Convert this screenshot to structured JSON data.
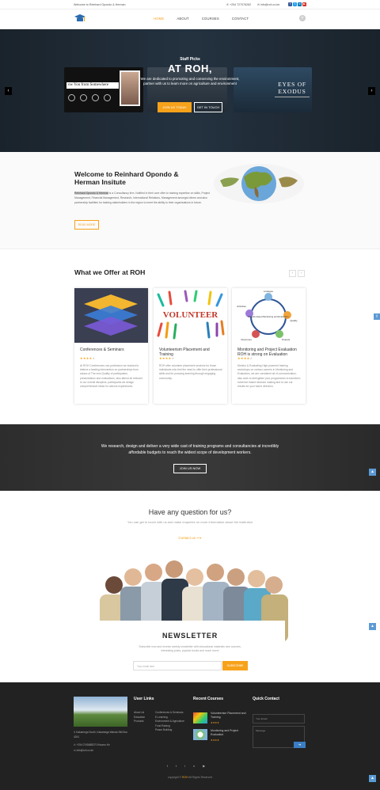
{
  "topbar": {
    "welcome": "Welcome to Reinhard Opondo & Herman",
    "phone": "+254 727076282",
    "email": "info@roh.co.ke"
  },
  "nav": {
    "items": [
      "HOME",
      "ABOUT",
      "COURSES",
      "CONTACT"
    ]
  },
  "hero": {
    "subtitle": "Staff Picks",
    "title": "AT ROH,",
    "text": "We are dedicated to promoting and conserving the environment, partner with us to learn more on agriculture and environment",
    "btn_primary": "JOIN US TODAY",
    "btn_secondary": "GET IN TOUCH",
    "slide1_banner": "ow You from Somewhere",
    "slide3_title": "EYES OF EXODUS"
  },
  "welcome": {
    "title": "Welcome to Reinhard Opondo & Herman Insitute",
    "highlight": "Reinhard Opondo & Herman",
    "text": " is a Consultancy firm. Notified in their core offer to training expertise on skills, Project Management, Financial Management, Research, International Relations, Management amongst others and also partnership facilities for training stakeholders in the region to meet the ability to their organisations in future.",
    "button": "READ MORE"
  },
  "offer": {
    "title": "What we Offer at ROH",
    "cards": [
      {
        "title": "Conferences & Seminars",
        "stars": "★★★★",
        "empty": "★",
        "desc": "At ROH Conferences non-profession we booked to believe a leading intervention on partnerships from aclass of The new Quality of participation, presentations and evaluations, also attend all relevant to our overall discipline, participants we design comprehensive ideas for various experiences."
      },
      {
        "title": "Volunteerism Placement and Training",
        "stars": "★★★★",
        "empty": "★",
        "desc": "ROH offer volunteer placement services for those individuals who feel the need to offer their professional skills and for pursuing learning through engaging community."
      },
      {
        "title": "Monitoring and Project Evaluation ROH is strong on Evaluation",
        "stars": "★★★★",
        "empty": "★",
        "desc": "Monitor & Evaluating High-powered training workshops on various careers in Monitoring and Evaluation, we are consistent all of communication, also work to strengthen your programmes to transform evidence based decision making and to use our results for your future direction."
      }
    ],
    "volunteer_banner": "VOLUNTEER",
    "diagram_labels": [
      "Linkages",
      "Results-based Monitoring and Evaluation",
      "Quality",
      "Outcomes",
      "Outputs",
      "Activities"
    ]
  },
  "cta": {
    "text": "We research, design and deliver a very wide cast of training programs and consultancies at incredibly affordable budgets to reach the widest scope of development workers.",
    "button": "JOIN US NOW"
  },
  "faq": {
    "title": "Have any question for us?",
    "subtitle": "You can get in touch with us and make enquiries on more information about the institution",
    "link": "Contact us ⟶"
  },
  "newsletter": {
    "title": "NEWSLETTER",
    "subtitle": "Subscribe now and receive weekly newsletter with educational materials new courses, interesting posts, popular books and much more!",
    "placeholder": "Your email here",
    "button": "SUBSCRIBE"
  },
  "footer": {
    "address": "Kakamega South, Kakamega Wanda Sitil Box 4241",
    "phone": "+254 0745488270 Kisumu Ke",
    "email": "info@roh.co.ke",
    "links_title": "User Links",
    "links_col1": [
      "About Us",
      "Education",
      "Products"
    ],
    "links_col2": [
      "Conferences & Seminars",
      "E-Learning",
      "Environment & Agriculture",
      "Fund Raising",
      "Peace Building"
    ],
    "recent_title": "Recent Courses",
    "recent": [
      {
        "title": "Volunteerism Placement and Training",
        "stars": "★★★★"
      },
      {
        "title": "Monitoring and Project Evaluation",
        "stars": "★★★★"
      }
    ],
    "contact_title": "Quick Contact",
    "email_placeholder": "Your Email",
    "message_placeholder": "Message",
    "copyright_pre": "copyright © ",
    "copyright_brand": "ROH",
    "copyright_post": " All Rights Reserved"
  }
}
